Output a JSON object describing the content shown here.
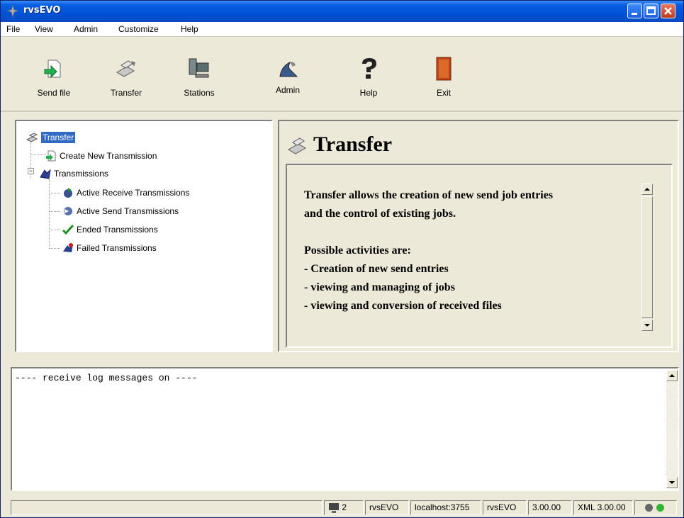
{
  "window": {
    "title": "rvsEVO"
  },
  "menu": [
    "File",
    "View",
    "Admin",
    "Customize",
    "Help"
  ],
  "toolbar": [
    {
      "label": "Send file",
      "icon": "send-file-icon"
    },
    {
      "label": "Transfer",
      "icon": "transfer-icon"
    },
    {
      "label": "Stations",
      "icon": "stations-icon"
    },
    {
      "label": "Admin",
      "icon": "admin-icon"
    },
    {
      "label": "Help",
      "icon": "help-icon"
    },
    {
      "label": "Exit",
      "icon": "exit-door-icon"
    }
  ],
  "tree": {
    "root": "Transfer",
    "create": "Create New Transmission",
    "transmissions": "Transmissions",
    "children": [
      "Active Receive Transmissions",
      "Active Send Transmissions",
      "Ended Transmissions",
      "Failed Transmissions"
    ]
  },
  "detail": {
    "title": "Transfer",
    "line1": "Transfer allows the creation of new send job entries",
    "line2": "and the control of existing jobs.",
    "line3": "Possible activities are:",
    "line4": "- Creation of new send entries",
    "line5": "- viewing and managing of jobs",
    "line6": "- viewing and conversion of received files"
  },
  "log": {
    "text": "---- receive log messages on ----"
  },
  "status": {
    "count": "2",
    "user": "rvsEVO",
    "host": "localhost:3755",
    "station": "rvsEVO",
    "version": "3.00.00",
    "xml": "XML 3.00.00"
  },
  "colors": {
    "titlebar": "#0052d6",
    "selection": "#316ac5",
    "led_off": "#666666",
    "led_on": "#2fb52f"
  }
}
